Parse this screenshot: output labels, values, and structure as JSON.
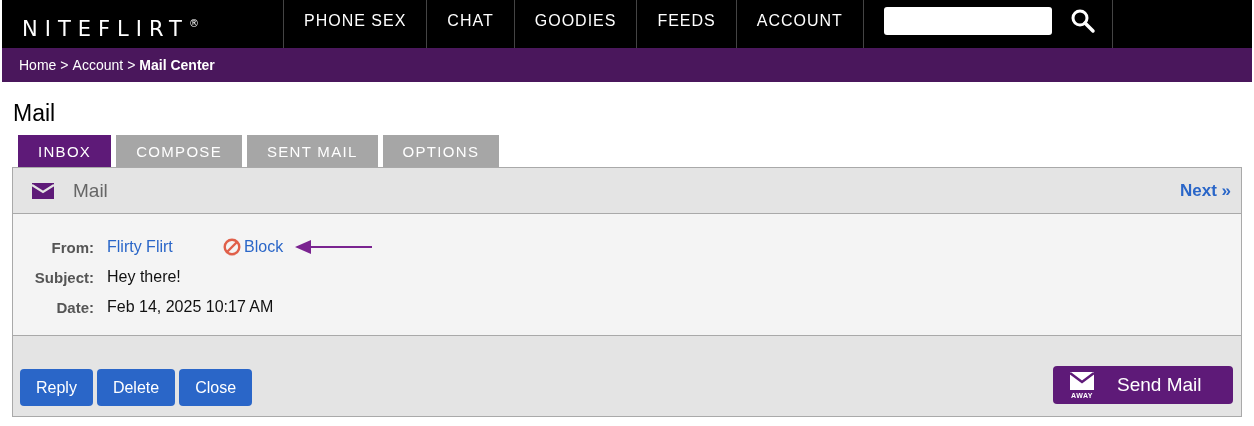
{
  "logo": {
    "text": "NITEFLIRT",
    "mark": "®"
  },
  "nav": [
    {
      "label": "PHONE SEX"
    },
    {
      "label": "CHAT"
    },
    {
      "label": "GOODIES"
    },
    {
      "label": "FEEDS"
    },
    {
      "label": "ACCOUNT"
    }
  ],
  "breadcrumb": [
    {
      "label": "Home",
      "current": false
    },
    {
      "label": "Account",
      "current": false
    },
    {
      "label": "Mail Center",
      "current": true
    }
  ],
  "breadcrumb_separator": ">",
  "page_title": "Mail",
  "tabs": [
    {
      "label": "INBOX",
      "selected": true
    },
    {
      "label": "COMPOSE",
      "selected": false
    },
    {
      "label": "SENT MAIL",
      "selected": false
    },
    {
      "label": "OPTIONS",
      "selected": false
    }
  ],
  "panel": {
    "title": "Mail",
    "next": "Next »"
  },
  "message": {
    "fields": [
      {
        "label": "From:",
        "value": "Flirty Flirt",
        "kind": "link"
      },
      {
        "label": "Subject:",
        "value": "Hey there!",
        "kind": "text"
      },
      {
        "label": "Date:",
        "value": "Feb 14, 2025 10:17 AM",
        "kind": "text"
      }
    ],
    "block": "Block"
  },
  "buttons": [
    {
      "label": "Reply"
    },
    {
      "label": "Delete"
    },
    {
      "label": "Close"
    }
  ],
  "send_mail": {
    "label": "Send Mail",
    "badge": "AWAY"
  }
}
